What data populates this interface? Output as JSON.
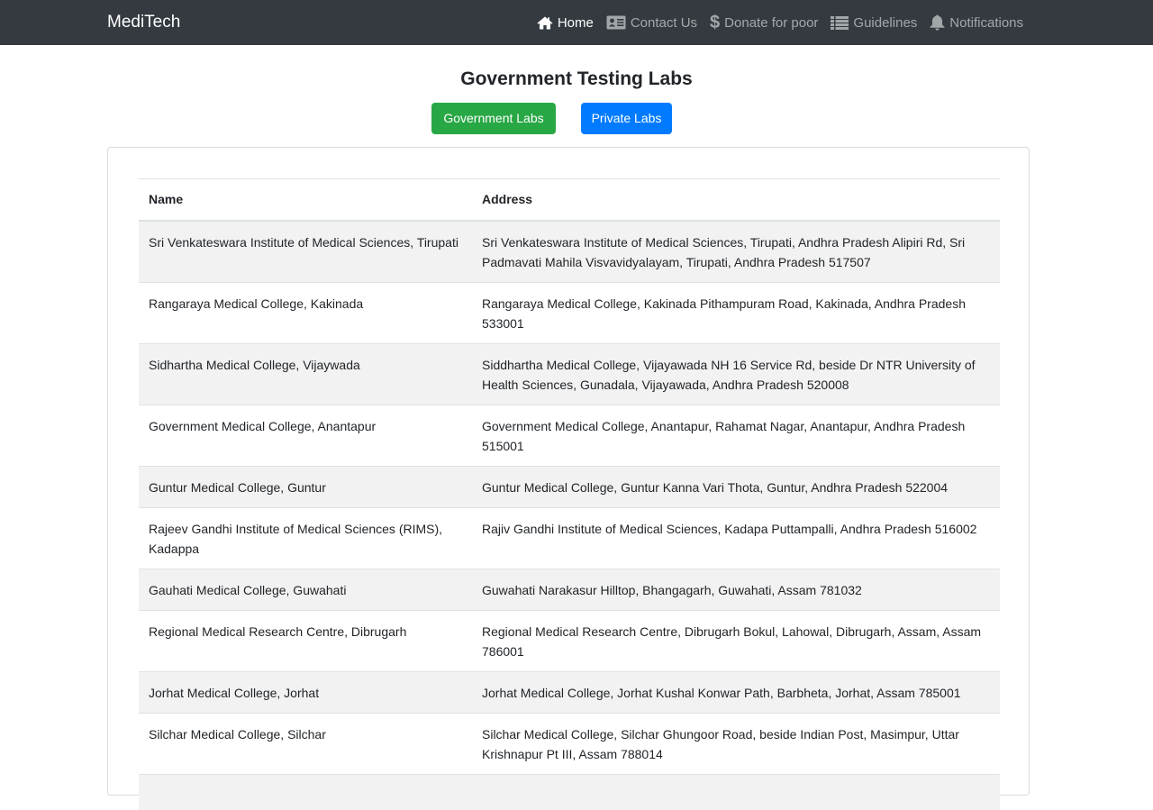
{
  "navbar": {
    "brand": "MediTech",
    "items": [
      {
        "icon": "home-icon",
        "label": "Home",
        "active": true
      },
      {
        "icon": "contact-card-icon",
        "label": "Contact Us",
        "active": false
      },
      {
        "icon": "dollar-icon",
        "label": "Donate for poor",
        "active": false
      },
      {
        "icon": "list-icon",
        "label": "Guidelines",
        "active": false
      },
      {
        "icon": "bell-icon",
        "label": "Notifications",
        "active": false
      }
    ]
  },
  "page": {
    "title": "Government Testing Labs",
    "gov_button": "Government Labs",
    "private_button": "Private Labs"
  },
  "table": {
    "headers": {
      "name": "Name",
      "address": "Address"
    },
    "rows": [
      {
        "name": "Sri Venkateswara Institute of Medical Sciences, Tirupati",
        "address": "Sri Venkateswara Institute of Medical Sciences, Tirupati, Andhra Pradesh Alipiri Rd, Sri Padmavati Mahila Visvavidyalayam, Tirupati, Andhra Pradesh 517507"
      },
      {
        "name": "Rangaraya Medical College, Kakinada",
        "address": "Rangaraya Medical College, Kakinada Pithampuram Road, Kakinada, Andhra Pradesh 533001"
      },
      {
        "name": "Sidhartha Medical College, Vijaywada",
        "address": "Siddhartha Medical College, Vijayawada NH 16 Service Rd, beside Dr NTR University of Health Sciences, Gunadala, Vijayawada, Andhra Pradesh 520008"
      },
      {
        "name": "Government Medical College, Anantapur",
        "address": "Government Medical College, Anantapur, Rahamat Nagar, Anantapur, Andhra Pradesh 515001"
      },
      {
        "name": "Guntur Medical College, Guntur",
        "address": "Guntur Medical College, Guntur Kanna Vari Thota, Guntur, Andhra Pradesh 522004"
      },
      {
        "name": "Rajeev Gandhi Institute of Medical Sciences (RIMS), Kadappa",
        "address": "Rajiv Gandhi Institute of Medical Sciences, Kadapa Puttampalli, Andhra Pradesh 516002"
      },
      {
        "name": "Gauhati Medical College, Guwahati",
        "address": "Guwahati Narakasur Hilltop, Bhangagarh, Guwahati, Assam 781032"
      },
      {
        "name": "Regional Medical Research Centre, Dibrugarh",
        "address": "Regional Medical Research Centre, Dibrugarh Bokul, Lahowal, Dibrugarh, Assam, Assam 786001"
      },
      {
        "name": "Jorhat Medical College, Jorhat",
        "address": "Jorhat Medical College, Jorhat Kushal Konwar Path, Barbheta, Jorhat, Assam 785001"
      },
      {
        "name": "Silchar Medical College, Silchar",
        "address": "Silchar Medical College, Silchar Ghungoor Road, beside Indian Post, Masimpur, Uttar Krishnapur Pt III, Assam 788014"
      }
    ]
  }
}
